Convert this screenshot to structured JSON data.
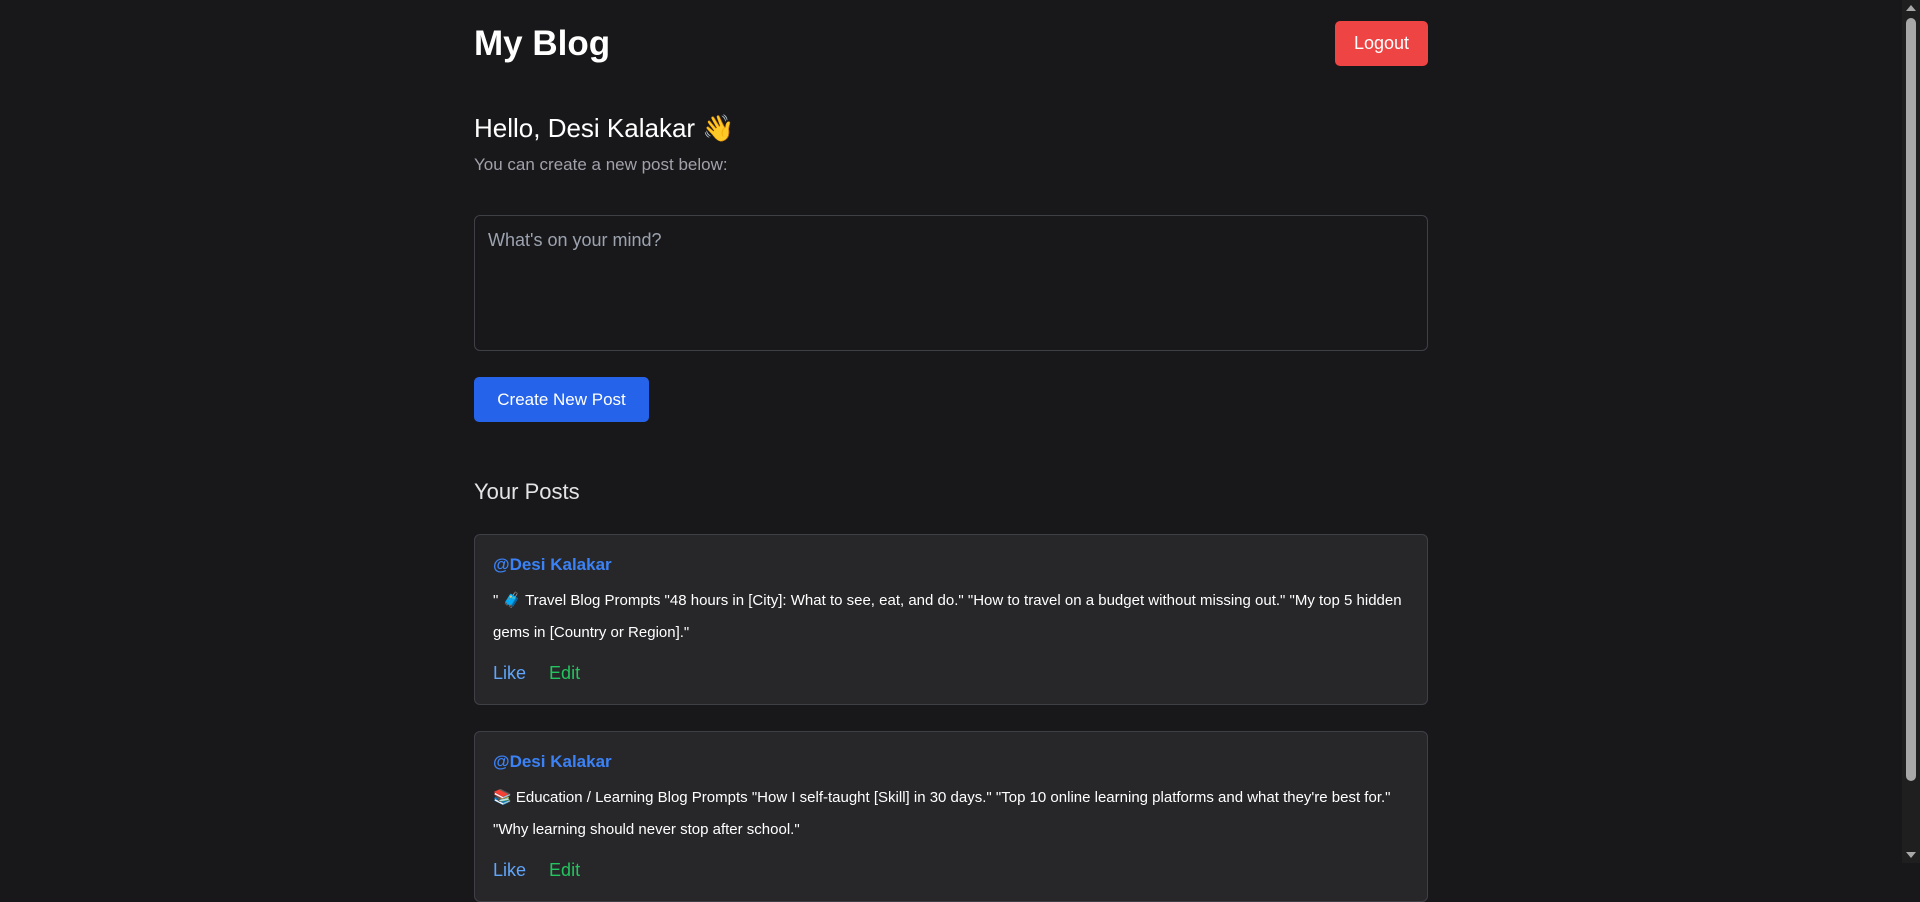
{
  "header": {
    "title": "My Blog",
    "logout_label": "Logout"
  },
  "greeting": {
    "hello": "Hello, Desi Kalakar 👋",
    "subtitle": "You can create a new post below:"
  },
  "composer": {
    "placeholder": "What's on your mind?",
    "value": "",
    "create_label": "Create New Post"
  },
  "posts_heading": "Your Posts",
  "posts": [
    {
      "author": "@Desi Kalakar",
      "text": "\" 🧳 Travel Blog Prompts \"48 hours in [City]: What to see, eat, and do.\" \"How to travel on a budget without missing out.\" \"My top 5 hidden gems in [Country or Region].\"",
      "like_label": "Like",
      "edit_label": "Edit"
    },
    {
      "author": "@Desi Kalakar",
      "text": "📚 Education / Learning Blog Prompts \"How I self-taught [Skill] in 30 days.\" \"Top 10 online learning platforms and what they're best for.\" \"Why learning should never stop after school.\"",
      "like_label": "Like",
      "edit_label": "Edit"
    }
  ],
  "colors": {
    "background": "#18181b",
    "card": "#27272a",
    "primary": "#2563eb",
    "danger": "#ef4444",
    "author": "#3b82f6",
    "edit": "#22c55e"
  }
}
